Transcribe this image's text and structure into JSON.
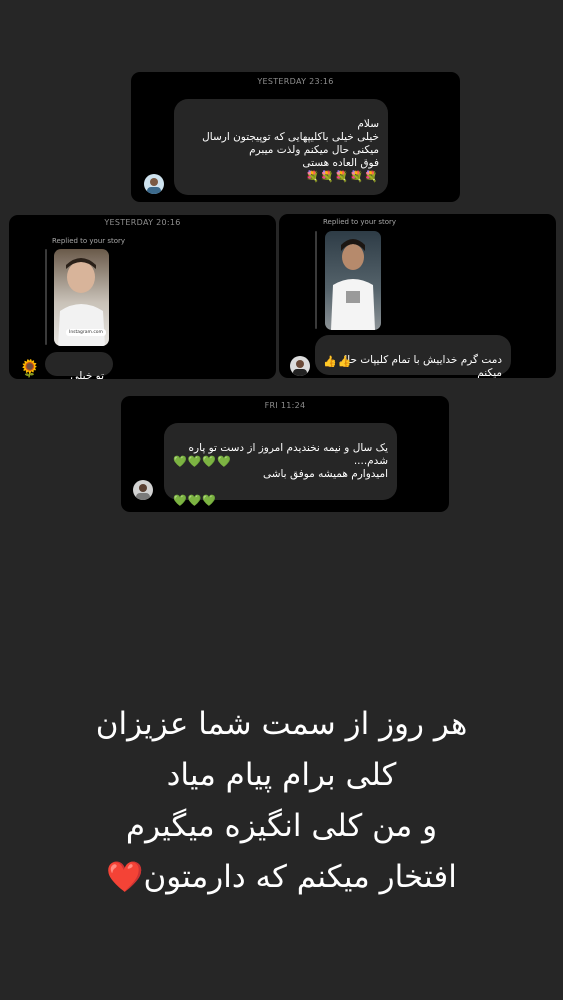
{
  "card1": {
    "timestamp": "YESTERDAY 23:16",
    "message": "سلام\nخیلی خیلی باکلیپهایی که توپیجتون ارسال\nمیکنی حال میکنم ولذت میبرم\nفوق العاده هستی",
    "emojis": "💐💐💐💐💐"
  },
  "card2": {
    "timestamp": "YESTERDAY 20:16",
    "replied": "Replied to your story",
    "thumb_label": "Instagram.com",
    "message": "تو خیلی خوبی",
    "avatar_emoji": "🌻"
  },
  "card3": {
    "replied": "Replied to your story",
    "message": "دمت گرم خداییش با تمام کلیپات حال میکنم\nعالی هستی عالی",
    "emojis": "👍👍"
  },
  "card4": {
    "timestamp": "FRI 11:24",
    "message": "یک سال و نیمه نخندیدم امروز از دست تو پاره\nشدم....\nامیدوارم همیشه موفق باشی",
    "emojis_inline": "💚💚💚💚",
    "emojis_line": "💚💚💚"
  },
  "caption": {
    "text": "هر روز از سمت شما عزیزان\nکلی برام پیام میاد\nو من کلی انگیزه میگیرم\nافتخار میکنم که دارمتون",
    "emoji": "❤️"
  },
  "colors": {
    "background": "#262626",
    "card": "#000000",
    "bubble": "#262626",
    "timestamp": "#8e8e8e"
  }
}
